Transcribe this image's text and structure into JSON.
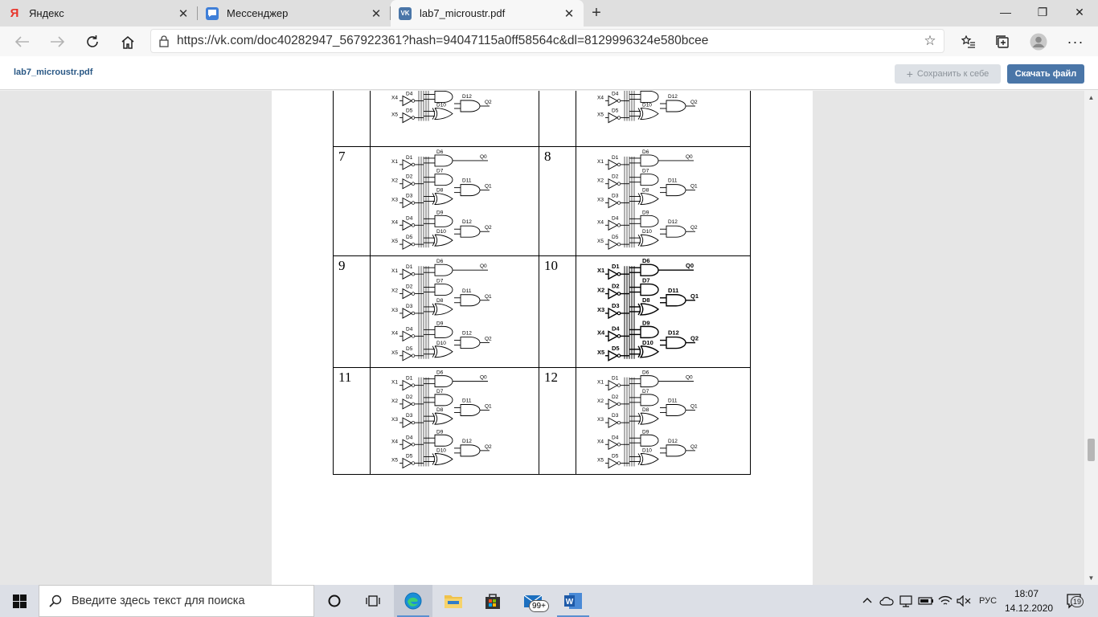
{
  "browser": {
    "tabs": [
      {
        "title": "Яндекс",
        "icon": "yandex-icon"
      },
      {
        "title": "Мессенджер",
        "icon": "messenger-icon"
      },
      {
        "title": "lab7_microustr.pdf",
        "icon": "vk-icon"
      }
    ],
    "new_tab": "+",
    "window_controls": {
      "minimize": "—",
      "maximize": "❐",
      "close": "✕"
    },
    "url": "https://vk.com/doc40282947_567922361?hash=94047115a0ff58564c&dl=8129996324e580bcee"
  },
  "doc_header": {
    "filename": "lab7_microustr.pdf",
    "save_label": "Сохранить к себе",
    "download_label": "Скачать файл"
  },
  "pdf": {
    "rows": [
      {
        "left": "",
        "right": ""
      },
      {
        "left": "7",
        "right": "8"
      },
      {
        "left": "9",
        "right": "10"
      },
      {
        "left": "11",
        "right": "12"
      }
    ],
    "labels": {
      "x": [
        "X1",
        "X2",
        "X3",
        "X4",
        "X5"
      ],
      "d_inv": [
        "D1",
        "D2",
        "D3",
        "D4",
        "D5"
      ],
      "d_and": [
        "D6",
        "D7",
        "D8",
        "D9",
        "D10"
      ],
      "d_out": [
        "D11",
        "D12"
      ],
      "q": [
        "Q0",
        "Q1",
        "Q2"
      ]
    }
  },
  "taskbar": {
    "search_placeholder": "Введите здесь текст для поиска",
    "mail_badge": "99+",
    "language": "РУС",
    "time": "18:07",
    "date": "14.12.2020",
    "notifications": "19"
  }
}
